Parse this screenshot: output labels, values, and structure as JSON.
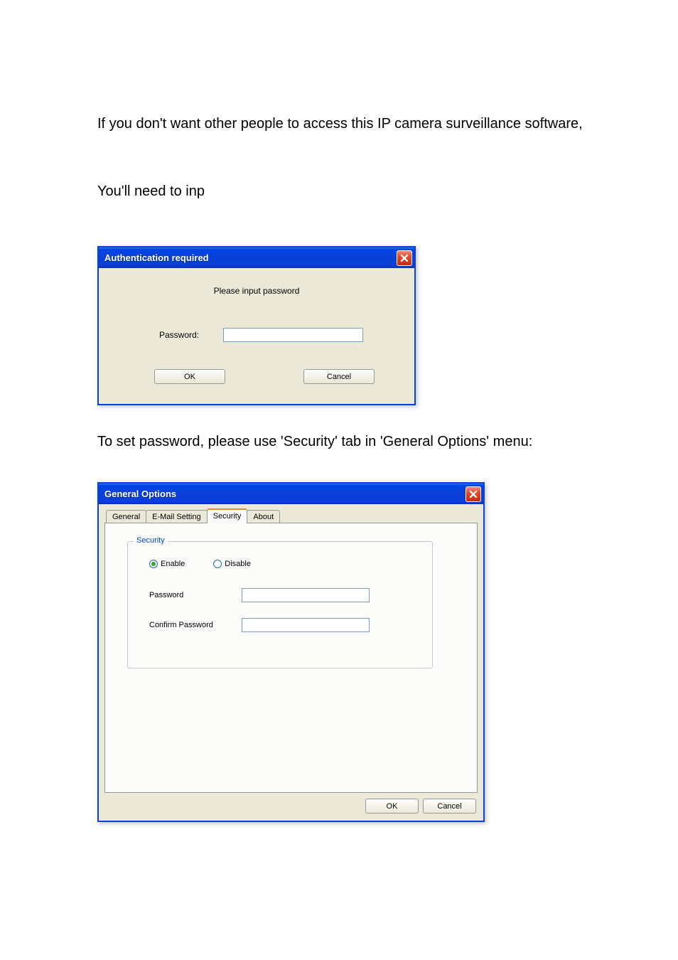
{
  "doc": {
    "para1": "If you don't want other people to access this IP camera surveillance software,",
    "para2": "You'll need to inp",
    "para3": "To set password, please use 'Security' tab in 'General Options' menu:"
  },
  "auth_dialog": {
    "title": "Authentication required",
    "message": "Please input password",
    "password_label": "Password:",
    "password_value": "",
    "ok_label": "OK",
    "cancel_label": "Cancel"
  },
  "options_dialog": {
    "title": "General Options",
    "tabs": {
      "general": "General",
      "email": "E-Mail Setting",
      "security": "Security",
      "about": "About",
      "active": "security"
    },
    "group_label": "Security",
    "enable_label": "Enable",
    "disable_label": "Disable",
    "security_enabled": true,
    "password_label": "Password",
    "password_value": "",
    "confirm_label": "Confirm Password",
    "confirm_value": "",
    "ok_label": "OK",
    "cancel_label": "Cancel"
  }
}
